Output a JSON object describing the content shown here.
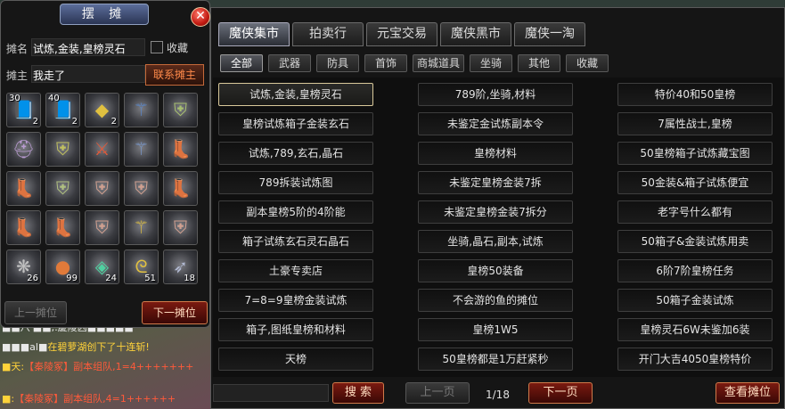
{
  "stall": {
    "title": "摆 摊",
    "close": "✕",
    "name_label": "摊名",
    "name_value": "试炼,金装,皇榜灵石",
    "favorite_label": "收藏",
    "owner_label": "摊主",
    "owner_value": "我走了",
    "contact_label": "联系摊主",
    "prev_label": "上一摊位",
    "next_label": "下一摊位",
    "items": [
      {
        "icon": "book-icon",
        "glyph": "📘",
        "color": "#8a5ad0",
        "top": "30",
        "count": "2"
      },
      {
        "icon": "book-icon",
        "glyph": "📘",
        "color": "#8a5ad0",
        "top": "40",
        "count": "2"
      },
      {
        "icon": "gem-icon",
        "glyph": "◆",
        "color": "#e0c040",
        "top": "",
        "count": "2"
      },
      {
        "icon": "staff-icon",
        "glyph": "⚚",
        "color": "#5a8ad0",
        "top": "",
        "count": ""
      },
      {
        "icon": "armor-icon",
        "glyph": "⛨",
        "color": "#a8c070",
        "top": "",
        "count": ""
      },
      {
        "icon": "helmet-icon",
        "glyph": "⛑",
        "color": "#b89ad0",
        "top": "",
        "count": ""
      },
      {
        "icon": "armor-icon",
        "glyph": "⛨",
        "color": "#c0c060",
        "top": "",
        "count": ""
      },
      {
        "icon": "sword-icon",
        "glyph": "⚔",
        "color": "#e05a3a",
        "top": "",
        "count": ""
      },
      {
        "icon": "staff-icon",
        "glyph": "⚚",
        "color": "#7a9ad0",
        "top": "",
        "count": ""
      },
      {
        "icon": "boots-icon",
        "glyph": "👢",
        "color": "#c0a070",
        "top": "",
        "count": ""
      },
      {
        "icon": "boots-icon",
        "glyph": "👢",
        "color": "#9a90c0",
        "top": "",
        "count": ""
      },
      {
        "icon": "armor-icon",
        "glyph": "⛨",
        "color": "#b0c080",
        "top": "",
        "count": ""
      },
      {
        "icon": "armor-icon",
        "glyph": "⛨",
        "color": "#d0a090",
        "top": "",
        "count": ""
      },
      {
        "icon": "armor-icon",
        "glyph": "⛨",
        "color": "#d0a090",
        "top": "",
        "count": ""
      },
      {
        "icon": "boots-icon",
        "glyph": "👢",
        "color": "#9a90c0",
        "top": "",
        "count": ""
      },
      {
        "icon": "boots-icon",
        "glyph": "👢",
        "color": "#90b080",
        "top": "",
        "count": ""
      },
      {
        "icon": "boots-icon",
        "glyph": "👢",
        "color": "#90b080",
        "top": "",
        "count": ""
      },
      {
        "icon": "armor-icon",
        "glyph": "⛨",
        "color": "#d0a090",
        "top": "",
        "count": ""
      },
      {
        "icon": "staff-icon",
        "glyph": "⚚",
        "color": "#e0c040",
        "top": "",
        "count": ""
      },
      {
        "icon": "armor-icon",
        "glyph": "⛨",
        "color": "#d0a090",
        "top": "",
        "count": ""
      },
      {
        "icon": "fan-icon",
        "glyph": "❋",
        "color": "#c0c0c0",
        "top": "",
        "count": "26"
      },
      {
        "icon": "orb-icon",
        "glyph": "●",
        "color": "#e07a3a",
        "top": "",
        "count": "99"
      },
      {
        "icon": "shell-icon",
        "glyph": "◈",
        "color": "#50d0a0",
        "top": "",
        "count": "24"
      },
      {
        "icon": "ring-icon",
        "glyph": "ᘓ",
        "color": "#e0c040",
        "top": "",
        "count": "51"
      },
      {
        "icon": "wing-icon",
        "glyph": "➶",
        "color": "#b0b8d0",
        "top": "",
        "count": "18"
      }
    ]
  },
  "chat": {
    "lines": [
      {
        "a": "■■八'■■,:慶陵凶■■■■■",
        "b": "",
        "c": ""
      },
      {
        "a": "■■■al■",
        "b": "在碧萝湖创下了十连斩!",
        "c": ""
      },
      {
        "a": "■天:",
        "b": "",
        "c": "【秦陵冢】副本组队,1=4+++++++"
      },
      {
        "a": "",
        "b": "",
        "c": ""
      },
      {
        "a": "■:",
        "b": "",
        "c": "【秦陵冢】副本组队,4=1++++++"
      }
    ]
  },
  "market": {
    "tabs": [
      "魔侠集市",
      "拍卖行",
      "元宝交易",
      "魔侠黑市",
      "魔侠一淘"
    ],
    "filters": [
      "全部",
      "武器",
      "防具",
      "首饰",
      "商城道具",
      "坐骑",
      "其他",
      "收藏"
    ],
    "entries": [
      [
        "试炼,金装,皇榜灵石",
        "789阶,坐骑,材料",
        "特价40和50皇榜"
      ],
      [
        "皇榜试炼箱子金装玄石",
        "未鉴定金试炼副本令",
        "7属性战士,皇榜"
      ],
      [
        "试炼,789,玄石,晶石",
        "皇榜材料",
        "50皇榜箱子试炼藏宝图"
      ],
      [
        "789拆装试炼图",
        "未鉴定皇榜金装7拆",
        "50金装&箱子试炼便宜"
      ],
      [
        "副本皇榜5阶的4阶能",
        "未鉴定皇榜金装7拆分",
        "老字号什么都有"
      ],
      [
        "箱子试练玄石灵石晶石",
        "坐骑,晶石,副本,试炼",
        "50箱子&金装试炼用卖"
      ],
      [
        "土豪专卖店",
        "皇榜50装备",
        "6阶7阶皇榜任务"
      ],
      [
        "7=8=9皇榜金装试炼",
        "不会游的鱼的摊位",
        "50箱子金装试炼"
      ],
      [
        "箱子,图纸皇榜和材料",
        "皇榜1W5",
        "皇榜灵石6W未鉴加6装"
      ],
      [
        "天榜",
        "50皇榜都是1万赶紧秒",
        "开门大吉4050皇榜特价"
      ]
    ],
    "search_label": "搜 索",
    "prev_label": "上一页",
    "page": "1/18",
    "next_label": "下一页",
    "view_label": "查看摊位"
  }
}
